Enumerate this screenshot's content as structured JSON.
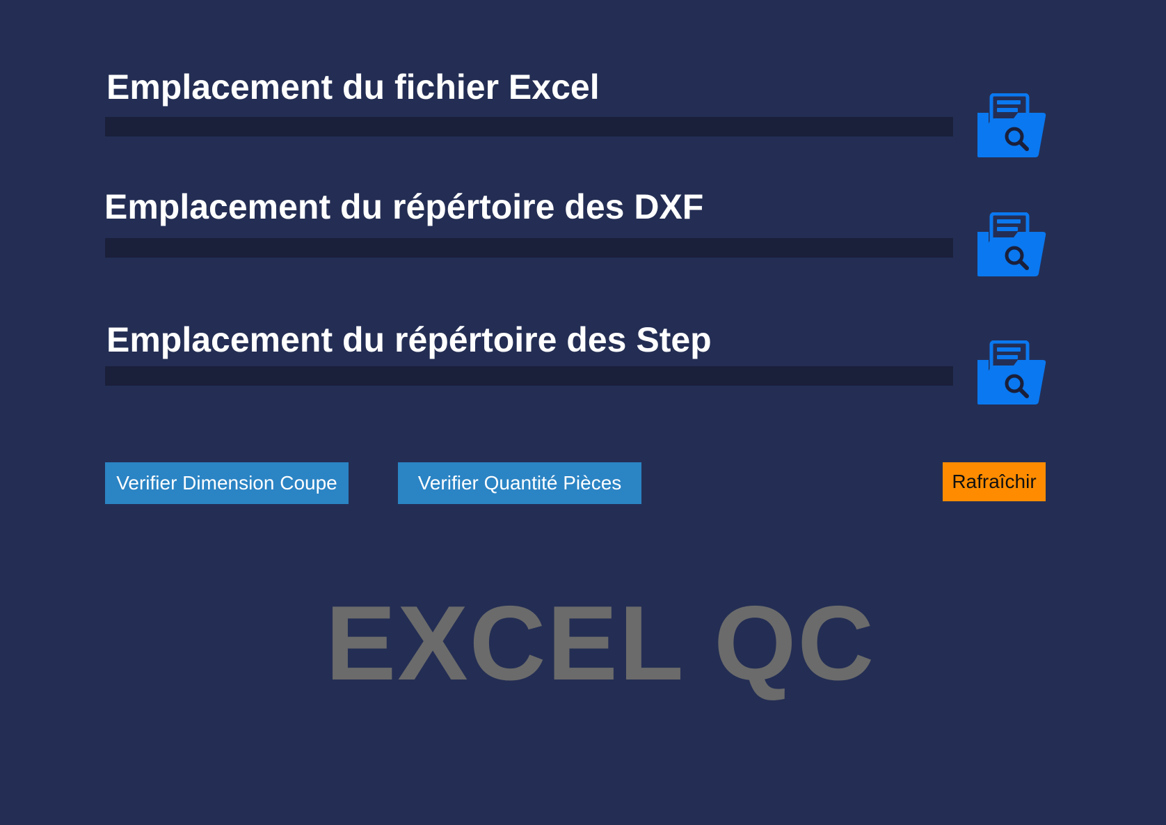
{
  "sections": [
    {
      "title": "Emplacement du fichier Excel",
      "path_value": "",
      "browse_icon": "folder-search-icon"
    },
    {
      "title": "Emplacement du répértoire des DXF",
      "path_value": "",
      "browse_icon": "folder-search-icon"
    },
    {
      "title": "Emplacement du répértoire des Step",
      "path_value": "",
      "browse_icon": "folder-search-icon"
    }
  ],
  "buttons": {
    "verify_dimension": "Verifier Dimension Coupe",
    "verify_quantity": "Verifier Quantité Pièces",
    "refresh": "Rafraîchir"
  },
  "brand": "EXCEL QC",
  "colors": {
    "background": "#242e54",
    "field": "#1a1f3a",
    "icon": "#0a78f0",
    "action_button": "#2b84c4",
    "refresh_button": "#ff8c00",
    "brand_text": "#6b6b6b"
  }
}
